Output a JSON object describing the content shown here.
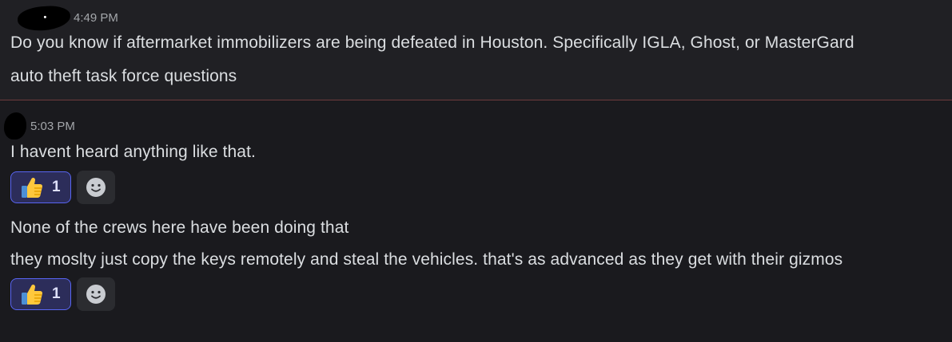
{
  "messages": [
    {
      "timestamp": "4:49 PM",
      "lines": [
        "Do you know if aftermarket immobilizers are being defeated in Houston. Specifically IGLA, Ghost, or MasterGard",
        "auto theft task force questions"
      ]
    },
    {
      "timestamp": "5:03 PM",
      "lines": [
        "I havent heard anything like that."
      ],
      "reaction": {
        "emoji": "thumbs-up",
        "count": "1"
      }
    },
    {
      "lines": [
        "None of the crews here have been doing that",
        "they moslty just copy the keys remotely and steal the vehicles. that's as advanced as they get with their gizmos"
      ],
      "reaction": {
        "emoji": "thumbs-up",
        "count": "1"
      }
    }
  ],
  "colors": {
    "background": "#1a1a1e",
    "highlighted_background": "#202024",
    "text": "#dbdee1",
    "timestamp": "#a3a6aa",
    "reaction_border": "#5865f2",
    "reaction_fill": "#2c2d5a",
    "new_messages_divider": "#6e3a3d"
  }
}
